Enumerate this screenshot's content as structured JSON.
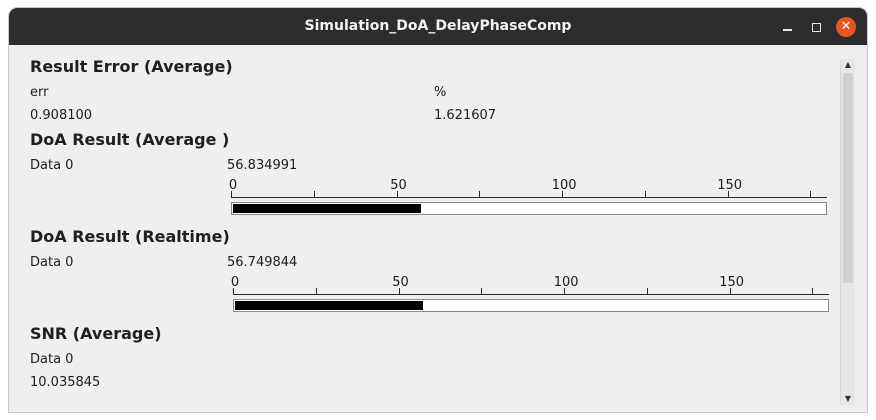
{
  "window": {
    "title": "Simulation_DoA_DelayPhaseComp",
    "close_glyph": "✕"
  },
  "result_error": {
    "heading": "Result Error (Average)",
    "col1_label": "err",
    "col2_label": "%",
    "col1_value": "0.908100",
    "col2_value": "1.621607"
  },
  "doa_average": {
    "heading": "DoA Result (Average )",
    "row_label": "Data 0",
    "value_text": "56.834991",
    "gauge": {
      "min": 0,
      "max": 180,
      "value": 56.834991,
      "tick_labels": [
        "0",
        "50",
        "100",
        "150"
      ]
    }
  },
  "doa_realtime": {
    "heading": "DoA Result (Realtime)",
    "row_label": "Data 0",
    "value_text": "56.749844",
    "gauge": {
      "min": 0,
      "max": 180,
      "value": 56.749844,
      "tick_labels": [
        "0",
        "50",
        "100",
        "150"
      ]
    }
  },
  "snr": {
    "heading": "SNR (Average)",
    "row_label": "Data 0",
    "value_text": "10.035845"
  },
  "icons": {
    "minimize": "minimize-icon",
    "maximize": "maximize-icon",
    "close": "close-icon",
    "scroll_up": "arrow-up-icon",
    "scroll_down": "arrow-down-icon"
  },
  "colors": {
    "titlebar": "#2d2d2d",
    "close_button": "#e95420",
    "gauge_fill": "#000000",
    "window_bg": "#efefef"
  }
}
